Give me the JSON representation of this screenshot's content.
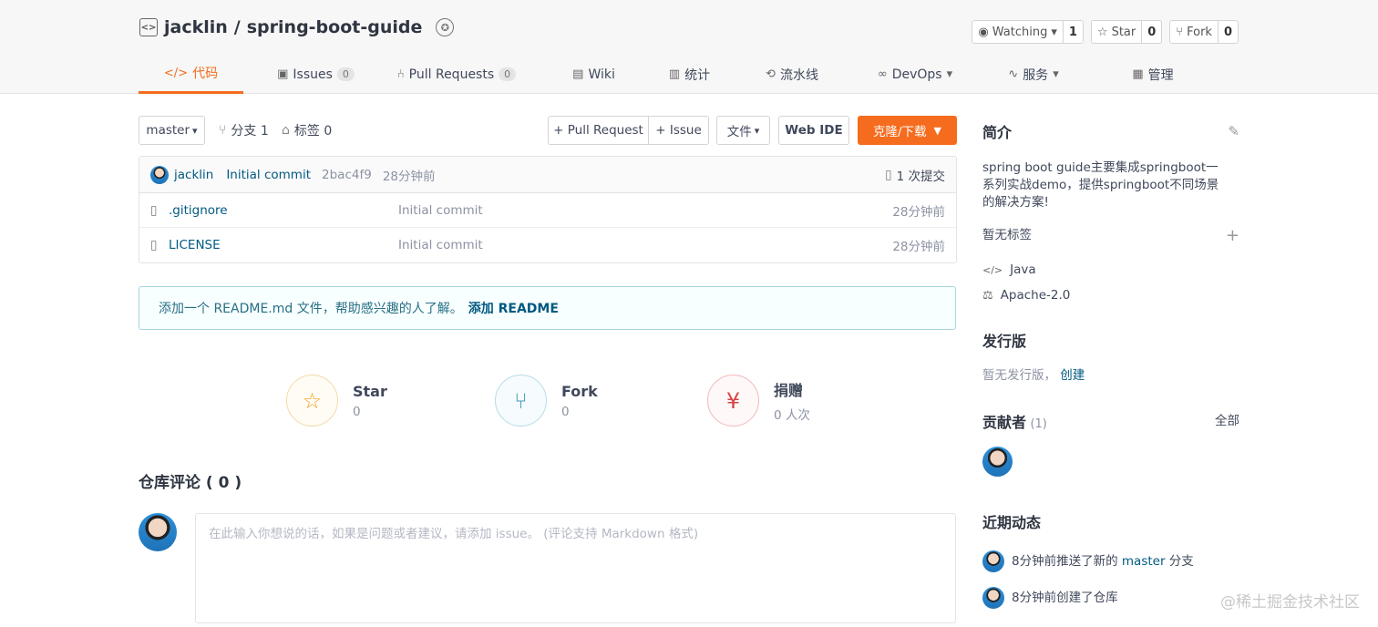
{
  "repo": {
    "owner": "jacklin",
    "separator": "/",
    "name": "spring-boot-guide"
  },
  "actions": [
    {
      "label": "Watching",
      "count": "1",
      "icon": "eye-icon",
      "caret": "▾"
    },
    {
      "label": "Star",
      "count": "0",
      "icon": "star-icon"
    },
    {
      "label": "Fork",
      "count": "0",
      "icon": "fork-icon"
    }
  ],
  "nav": {
    "code": "代码",
    "issues": "Issues",
    "issues_count": "0",
    "pull_requests": "Pull Requests",
    "pull_requests_count": "0",
    "wiki": "Wiki",
    "stats": "统计",
    "pipeline": "流水线",
    "devops": "DevOps",
    "services": "服务",
    "manage": "管理"
  },
  "toolbar": {
    "branch": "master",
    "branches": "分支 1",
    "tags": "标签 0",
    "pull_request": "+ Pull Request",
    "issue": "+ Issue",
    "files": "文件",
    "web_ide": "Web IDE",
    "clone": "克隆/下载"
  },
  "commit": {
    "author": "jacklin",
    "message": "Initial commit",
    "hash": "2bac4f9",
    "time": "28分钟前",
    "count": "1 次提交"
  },
  "files": [
    {
      "name": ".gitignore",
      "message": "Initial commit",
      "time": "28分钟前"
    },
    {
      "name": "LICENSE",
      "message": "Initial commit",
      "time": "28分钟前"
    }
  ],
  "readme": {
    "tip": "添加一个 README.md 文件，帮助感兴趣的人了解。",
    "action": "添加 README"
  },
  "stats": {
    "star_label": "Star",
    "star_count": "0",
    "fork_label": "Fork",
    "fork_count": "0",
    "donate_label": "捐赠",
    "donate_count": "0 人次"
  },
  "comments": {
    "title": "仓库评论 ( 0 )",
    "placeholder": "在此输入你想说的话，如果是问题或者建议，请添加 issue。 (评论支持 Markdown 格式)"
  },
  "sidebar": {
    "intro_title": "简介",
    "intro_text": "spring boot guide主要集成springboot一系列实战demo，提供springboot不同场景的解决方案!",
    "no_tags": "暂无标签",
    "language": "Java",
    "license": "Apache-2.0",
    "releases_title": "发行版",
    "no_releases": "暂无发行版，",
    "create": "创建",
    "contributors_title": "贡献者",
    "contributors_count": "(1)",
    "all": "全部",
    "activity_title": "近期动态",
    "activity1_prefix": "8分钟前推送了新的",
    "activity1_branch": "master",
    "activity1_suffix": "分支",
    "activity2": "8分钟前创建了仓库"
  },
  "watermark": "@稀土掘金技术社区",
  "colors": {
    "accent": "#f56c1e",
    "link": "#005980",
    "tip_border": "#a9d5de"
  }
}
